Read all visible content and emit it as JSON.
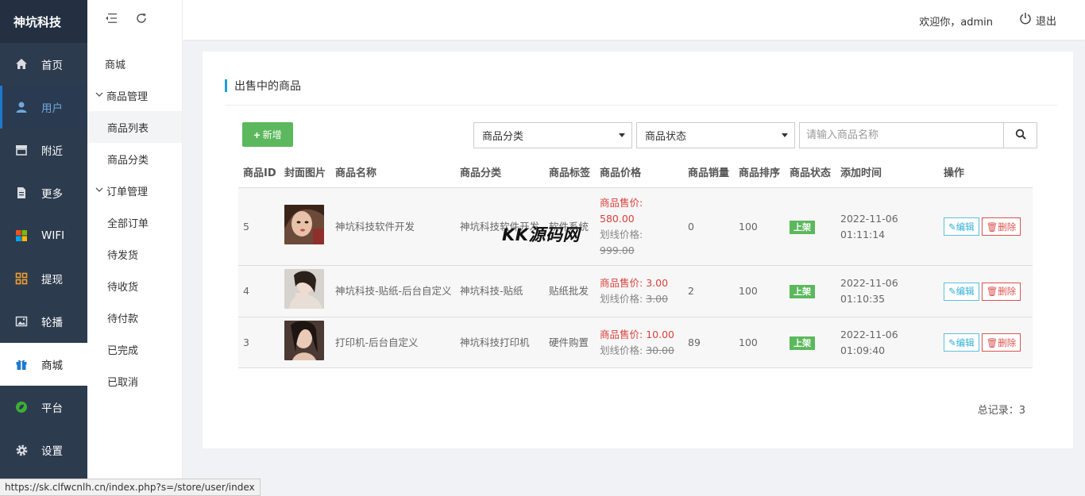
{
  "brand": "神坑科技",
  "sidebar": {
    "items": [
      {
        "label": "首页",
        "icon": "home-icon"
      },
      {
        "label": "用户",
        "icon": "user-icon"
      },
      {
        "label": "附近",
        "icon": "store-icon"
      },
      {
        "label": "更多",
        "icon": "document-icon"
      },
      {
        "label": "WIFI",
        "icon": "windows-icon"
      },
      {
        "label": "提现",
        "icon": "grid-icon"
      },
      {
        "label": "轮播",
        "icon": "image-icon"
      },
      {
        "label": "商城",
        "icon": "gift-icon"
      },
      {
        "label": "平台",
        "icon": "leaf-icon"
      },
      {
        "label": "设置",
        "icon": "gear-icon"
      }
    ]
  },
  "subnav": {
    "top": "商城",
    "group1": "商品管理",
    "group1_items": [
      "商品列表",
      "商品分类"
    ],
    "group2": "订单管理",
    "group2_items": [
      "全部订单",
      "待发货",
      "待收货",
      "待付款",
      "已完成",
      "已取消"
    ]
  },
  "header": {
    "welcome": "欢迎你，admin",
    "logout": "退出"
  },
  "card": {
    "title": "出售中的商品",
    "add_label": "新增",
    "category_select": "商品分类",
    "status_select": "商品状态",
    "search_placeholder": "请输入商品名称"
  },
  "table": {
    "headers": [
      "商品ID",
      "封面图片",
      "商品名称",
      "商品分类",
      "商品标签",
      "商品价格",
      "商品销量",
      "商品排序",
      "商品状态",
      "添加时间",
      "操作"
    ],
    "sale_label": "商品售价:",
    "line_label": "划线价格:",
    "edit_label": "编辑",
    "delete_label": "删除",
    "rows": [
      {
        "id": "5",
        "name": "神坑科技软件开发",
        "category": "神坑科技软件开发",
        "tag": "软件系统",
        "sale": "580.00",
        "line": "999.00",
        "sales": "0",
        "sort": "100",
        "status": "上架",
        "time": "2022-11-06 01:11:14"
      },
      {
        "id": "4",
        "name": "神坑科技-贴纸-后台自定义",
        "category": "神坑科技-贴纸",
        "tag": "贴纸批发",
        "sale": "3.00",
        "line": "3.00",
        "sales": "2",
        "sort": "100",
        "status": "上架",
        "time": "2022-11-06 01:10:35"
      },
      {
        "id": "3",
        "name": "打印机-后台自定义",
        "category": "神坑科技打印机",
        "tag": "硬件购置",
        "sale": "10.00",
        "line": "30.00",
        "sales": "89",
        "sort": "100",
        "status": "上架",
        "time": "2022-11-06 01:09:40"
      }
    ]
  },
  "total": "总记录：3",
  "watermark": "KK源码网",
  "statusbar": "https://sk.clfwcnlh.cn/index.php?s=/store/user/index"
}
